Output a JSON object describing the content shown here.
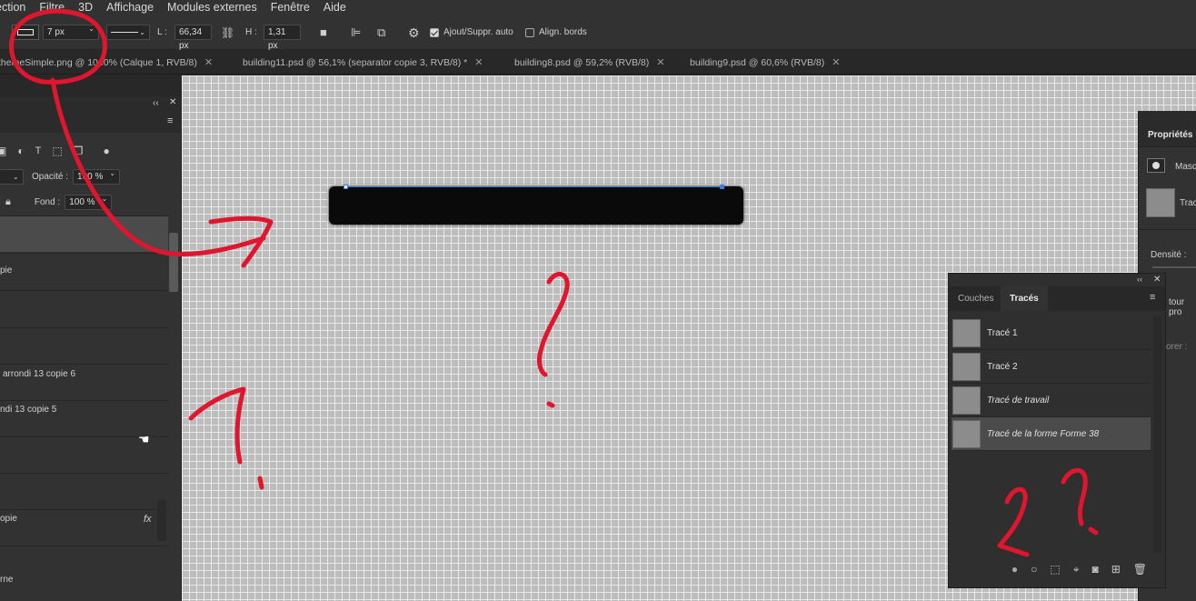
{
  "menu": [
    "ection",
    "Filtre",
    "3D",
    "Affichage",
    "Modules externes",
    "Fenêtre",
    "Aide"
  ],
  "options": {
    "stroke_width": "7 px",
    "width_label": "L :",
    "width_value": "66,34 px",
    "height_label": "H :",
    "height_value": "1,31 px",
    "auto_add_delete": "Ajout/Suppr. auto",
    "align_edges": "Align. bords"
  },
  "tabs": [
    {
      "label": "themeSimple.png @ 1040% (Calque 1, RVB/8)"
    },
    {
      "label": "building11.psd @ 56,1% (separator copie 3, RVB/8) *"
    },
    {
      "label": "building8.psd @ 59,2% (RVB/8)"
    },
    {
      "label": "building9.psd @ 60,6% (RVB/8)"
    }
  ],
  "layers": {
    "opacity_label": "Opacité :",
    "opacity_value": "100 %",
    "fill_label": "Fond :",
    "fill_value": "100 %",
    "rows": [
      {
        "label": "pie"
      },
      {
        "label": "arrondi 13 copie 6"
      },
      {
        "label": "ndi 13 copie 5"
      },
      {
        "label": "opie"
      },
      {
        "label": "rne"
      }
    ],
    "fx_label": "fx"
  },
  "properties": {
    "title": "Propriétés",
    "mask_label": "Masq",
    "path_label": "Trac",
    "density_label": "Densité :",
    "contour_label": "tour pro",
    "ignore_label": "orer :"
  },
  "paths_panel": {
    "tab_channels": "Couches",
    "tab_paths": "Tracés",
    "items": [
      {
        "name": "Tracé 1"
      },
      {
        "name": "Tracé 2"
      },
      {
        "name": "Tracé de travail"
      },
      {
        "name": "Tracé de la forme Forme 38"
      }
    ]
  },
  "colors": {
    "annotation": "#e0152e",
    "path_blue": "#3b7fe0"
  }
}
